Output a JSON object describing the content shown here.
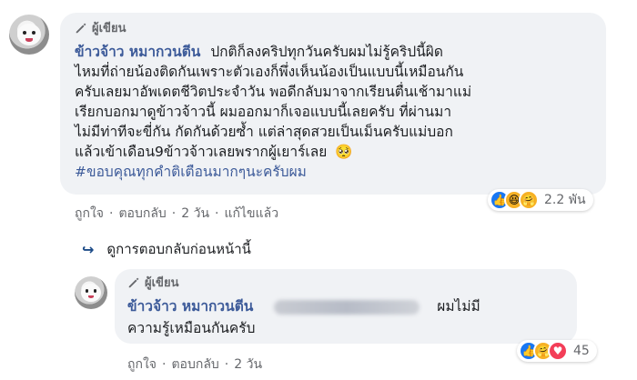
{
  "comment": {
    "author_badge": "ผู้เขียน",
    "author_name": "ข้าวจ้าว หมากวนตีน",
    "lines": [
      "ปกติก็ลงคริปทุกวันครับผมไม่รู้คริปนี้ผิด",
      "ไหมที่ถ่ายน้องติดกันเพราะตัวเองก็พึ่งเห็นน้องเป็นแบบนี้เหมือนกัน",
      "ครับเลยมาอัพเดตชีวิตประจำวัน พอดีกลับมาจากเรียนตื่นเช้ามาแม่",
      "เรียกบอกมาดูข้าวจ้าวนี้ ผมออกมาก็เจอแบบนี้เลยครับ ที่ผ่านมา",
      "ไม่มีท่าทีจะขี่กัน กัดกันด้วยซ้ำ แต่ล่าสุดสวยเป็นเม็นครับแม่บอก",
      "แล้วเข้าเดือน9ข้าวจ้าวเลยพรากผู้เยาร์เลย"
    ],
    "emoji": "🥺",
    "hashtag": "#ขอบคุณทุกคำติเตือนมากๆนะครับผม",
    "reactions": [
      "like-icon",
      "haha-icon",
      "care-icon"
    ],
    "reaction_count": "2.2 พัน",
    "actions": {
      "like": "ถูกใจ",
      "reply": "ตอบกลับ",
      "time": "2 วัน",
      "edited": "แก้ไขแล้ว",
      "separator": "·"
    }
  },
  "previous_replies_label": "ดูการตอบกลับก่อนหน้านี้",
  "reply": {
    "author_badge": "ผู้เขียน",
    "author_name": "ข้าวจ้าว หมากวนตีน",
    "text_part1": "ผมไม่มี",
    "text_line2": "ความรู้เหมือนกันครับ",
    "reactions": [
      "like-icon",
      "care-icon",
      "love-icon"
    ],
    "reaction_count": "45",
    "actions": {
      "like": "ถูกใจ",
      "reply": "ตอบกลับ",
      "time": "2 วัน",
      "separator": "·"
    }
  }
}
